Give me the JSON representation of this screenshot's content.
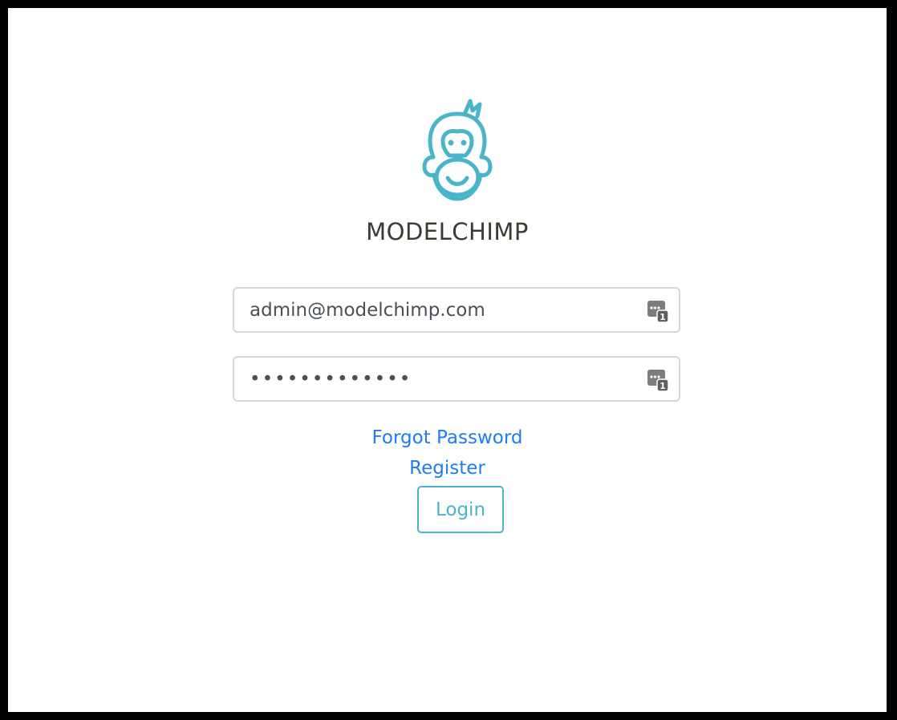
{
  "brand": {
    "name": "MODELCHIMP",
    "logo_icon": "chimp-logo-icon",
    "accent_color": "#4ab5c9"
  },
  "form": {
    "email": {
      "value": "admin@modelchimp.com",
      "icon": "password-manager-icon"
    },
    "password": {
      "value": "•••••••••••••",
      "icon": "password-manager-icon"
    },
    "forgot_password_label": "Forgot Password",
    "register_label": "Register",
    "login_label": "Login",
    "link_color": "#1e7cf0"
  }
}
